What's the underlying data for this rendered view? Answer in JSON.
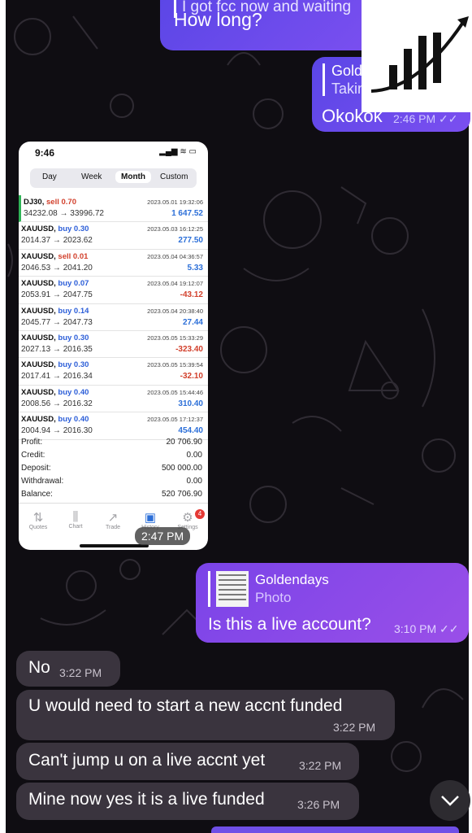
{
  "messages_top": {
    "quote_text": "I got fcc now and waiting",
    "message": "How long?"
  },
  "reply_ok": {
    "quote_author": "Gold",
    "quote_text": "Takin",
    "message": "Okokok",
    "time": "2:46 PM"
  },
  "photo": {
    "status_time": "9:46",
    "tabs": [
      "Day",
      "Week",
      "Month",
      "Custom"
    ],
    "active_tab": "Month",
    "trades": [
      {
        "symbol": "DJ30,",
        "side": "sell 0.70",
        "prices": "34232.08 → 33996.72",
        "date": "2023.05.01 19:32:06",
        "pnl": "1 647.52"
      },
      {
        "symbol": "XAUUSD,",
        "side": "buy 0.30",
        "prices": "2014.37 → 2023.62",
        "date": "2023.05.03 16:12:25",
        "pnl": "277.50"
      },
      {
        "symbol": "XAUUSD,",
        "side": "sell 0.01",
        "prices": "2046.53 → 2041.20",
        "date": "2023.05.04 04:36:57",
        "pnl": "5.33"
      },
      {
        "symbol": "XAUUSD,",
        "side": "buy 0.07",
        "prices": "2053.91 → 2047.75",
        "date": "2023.05.04 19:12:07",
        "pnl": "-43.12"
      },
      {
        "symbol": "XAUUSD,",
        "side": "buy 0.14",
        "prices": "2045.77 → 2047.73",
        "date": "2023.05.04 20:38:40",
        "pnl": "27.44"
      },
      {
        "symbol": "XAUUSD,",
        "side": "buy 0.30",
        "prices": "2027.13 → 2016.35",
        "date": "2023.05.05 15:33:29",
        "pnl": "-323.40"
      },
      {
        "symbol": "XAUUSD,",
        "side": "buy 0.30",
        "prices": "2017.41 → 2016.34",
        "date": "2023.05.05 15:39:54",
        "pnl": "-32.10"
      },
      {
        "symbol": "XAUUSD,",
        "side": "buy 0.40",
        "prices": "2008.56 → 2016.32",
        "date": "2023.05.05 15:44:46",
        "pnl": "310.40"
      },
      {
        "symbol": "XAUUSD,",
        "side": "buy 0.40",
        "prices": "2004.94 → 2016.30",
        "date": "2023.05.05 17:12:37",
        "pnl": "454.40"
      }
    ],
    "summary": [
      {
        "label": "Profit:",
        "value": "20 706.90"
      },
      {
        "label": "Credit:",
        "value": "0.00"
      },
      {
        "label": "Deposit:",
        "value": "500 000.00"
      },
      {
        "label": "Withdrawal:",
        "value": "0.00"
      },
      {
        "label": "Balance:",
        "value": "520 706.90"
      }
    ],
    "tabbar": [
      "Quotes",
      "Chart",
      "Trade",
      "History",
      "Settings"
    ],
    "badge": "4",
    "time": "2:47 PM"
  },
  "reply_live": {
    "quote_author": "Goldendays",
    "quote_type": "Photo",
    "message": "Is this a live account?",
    "time": "3:10 PM"
  },
  "incoming": [
    {
      "text": "No",
      "time": "3:22 PM"
    },
    {
      "text": "U would need to start a new accnt funded",
      "time": "3:22 PM"
    },
    {
      "text": "Can't jump u on a live accnt yet",
      "time": "3:22 PM"
    },
    {
      "text": "Mine now yes it is a live funded",
      "time": "3:26 PM"
    }
  ],
  "colors": {
    "outgoing": "#5a46e6",
    "reply": "#8a4ae8",
    "incoming": "#46404a",
    "profit": "#2c6fd8",
    "loss": "#d2402c"
  }
}
